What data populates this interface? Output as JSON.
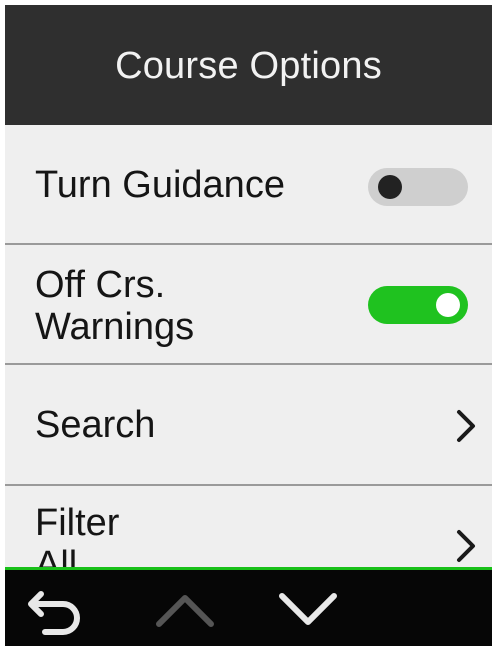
{
  "header": {
    "title": "Course Options"
  },
  "rows": [
    {
      "label": "Turn Guidance",
      "control": "toggle",
      "toggle_state": "off"
    },
    {
      "label_line1": "Off Crs.",
      "label_line2": "Warnings",
      "control": "toggle",
      "toggle_state": "on"
    },
    {
      "label": "Search",
      "control": "chevron-right-icon"
    },
    {
      "label": "Filter",
      "sublabel": "All",
      "control": "chevron-right-icon"
    }
  ],
  "colors": {
    "header_bg": "#2f2f2f",
    "list_bg": "#efefef",
    "toggle_on": "#1fc21f",
    "toggle_off": "#cfcfcf",
    "bottom_bar_bg": "#060606",
    "accent_line": "#19c019"
  },
  "bottom_bar": {
    "buttons": [
      {
        "icon": "back-arrow-icon",
        "enabled": true
      },
      {
        "icon": "chevron-up-icon",
        "enabled": false
      },
      {
        "icon": "chevron-down-icon",
        "enabled": true
      }
    ]
  }
}
